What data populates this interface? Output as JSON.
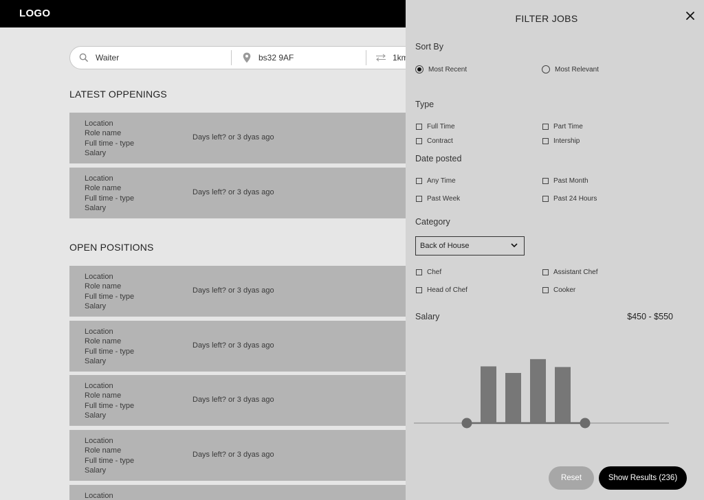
{
  "header": {
    "logo": "LOGO"
  },
  "search": {
    "keyword": "Waiter",
    "location": "bs32 9AF",
    "distance": "1km"
  },
  "latest": {
    "title": "LATEST OPPENINGS",
    "cards": [
      {
        "location": "Location",
        "role": "Role name",
        "type": "Full time - type",
        "salary": "Salary",
        "days": "Days left? or 3 dyas ago"
      },
      {
        "location": "Location",
        "role": "Role name",
        "type": "Full time - type",
        "salary": "Salary",
        "days": "Days left? or 3 dyas ago"
      }
    ]
  },
  "open": {
    "title": "OPEN POSITIONS",
    "cards": [
      {
        "location": "Location",
        "role": "Role name",
        "type": "Full time - type",
        "salary": "Salary",
        "days": "Days left? or 3 dyas ago"
      },
      {
        "location": "Location",
        "role": "Role name",
        "type": "Full time - type",
        "salary": "Salary",
        "days": "Days left? or 3 dyas ago"
      },
      {
        "location": "Location",
        "role": "Role name",
        "type": "Full time - type",
        "salary": "Salary",
        "days": "Days left? or 3 dyas ago"
      },
      {
        "location": "Location",
        "role": "Role name",
        "type": "Full time - type",
        "salary": "Salary",
        "days": "Days left? or 3 dyas ago"
      },
      {
        "location": "Location"
      }
    ]
  },
  "filter": {
    "title": "FILTER JOBS",
    "sort": {
      "label": "Sort By",
      "options": [
        {
          "label": "Most Recent",
          "selected": true
        },
        {
          "label": "Most Relevant",
          "selected": false
        }
      ]
    },
    "type": {
      "label": "Type",
      "options": [
        "Full Time",
        "Part Time",
        "Contract",
        "Intership"
      ]
    },
    "date": {
      "label": "Date posted",
      "options": [
        "Any Time",
        "Past Month",
        "Past Week",
        "Past 24 Hours"
      ]
    },
    "category": {
      "label": "Category",
      "selected": "Back of House",
      "options": [
        "Chef",
        "Assistant Chef",
        "Head of Chef",
        "Cooker"
      ]
    },
    "salary": {
      "label": "Salary",
      "range": "$450 - $550",
      "histogram": [
        0.86,
        0.76,
        0.97,
        0.85
      ],
      "handles": [
        0,
        1
      ]
    },
    "reset_label": "Reset",
    "show_label": "Show Results (236)"
  },
  "colors": {
    "topbar": "#000000",
    "card": "#b4b4b4",
    "panel": "#d4d4d4",
    "bar": "#777777",
    "primary_button": "#000000",
    "reset_button": "#a7a7a7"
  }
}
